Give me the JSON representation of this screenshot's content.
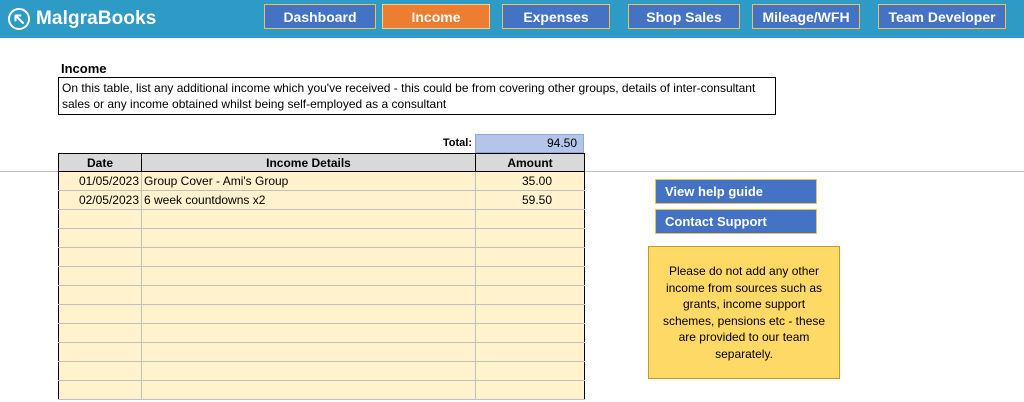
{
  "app": {
    "name": "MalgraBooks",
    "logo_icon": "arrow-up-left-circle-icon"
  },
  "nav": [
    {
      "label": "Dashboard",
      "active": false
    },
    {
      "label": "Income",
      "active": true
    },
    {
      "label": "Expenses",
      "active": false
    },
    {
      "label": "Shop Sales",
      "active": false
    },
    {
      "label": "Mileage/WFH",
      "active": false
    },
    {
      "label": "Team Developer",
      "active": false
    }
  ],
  "colors": {
    "header": "#2e9ac6",
    "nav_button": "#4472c4",
    "nav_active": "#ed7d31",
    "table_fill": "#fff2cc",
    "total_fill": "#b4c6e7",
    "note_fill": "#ffd966"
  },
  "section": {
    "title": "Income",
    "description": "On this table, list any additional income which you've received - this could be from covering other groups, details of inter-consultant sales or any income obtained whilst being self-employed as a consultant"
  },
  "total": {
    "label": "Total:",
    "value": "94.50"
  },
  "table": {
    "headers": {
      "date": "Date",
      "details": "Income Details",
      "amount": "Amount"
    },
    "rows": [
      {
        "date": "01/05/2023",
        "details": "Group Cover - Ami's Group",
        "amount": "35.00"
      },
      {
        "date": "02/05/2023",
        "details": "6 week countdowns x2",
        "amount": "59.50"
      },
      {
        "date": "",
        "details": "",
        "amount": ""
      },
      {
        "date": "",
        "details": "",
        "amount": ""
      },
      {
        "date": "",
        "details": "",
        "amount": ""
      },
      {
        "date": "",
        "details": "",
        "amount": ""
      },
      {
        "date": "",
        "details": "",
        "amount": ""
      },
      {
        "date": "",
        "details": "",
        "amount": ""
      },
      {
        "date": "",
        "details": "",
        "amount": ""
      },
      {
        "date": "",
        "details": "",
        "amount": ""
      },
      {
        "date": "",
        "details": "",
        "amount": ""
      },
      {
        "date": "",
        "details": "",
        "amount": ""
      }
    ]
  },
  "side": {
    "help_label": "View help guide",
    "support_label": "Contact Support",
    "note": "Please do not add any other income from sources such as grants, income support schemes, pensions etc - these are provided to our team separately."
  }
}
